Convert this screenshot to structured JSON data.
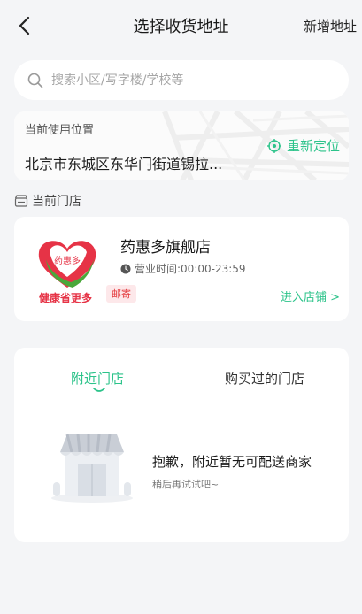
{
  "nav": {
    "title": "选择收货地址",
    "add_address": "新增地址"
  },
  "search": {
    "placeholder": "搜索小区/写字楼/学校等",
    "value": ""
  },
  "location": {
    "label": "当前使用位置",
    "address": "北京市东城区东华门街道锡拉...",
    "relocate": "重新定位"
  },
  "current_store_section": {
    "title": "当前门店"
  },
  "store": {
    "logo_text_top": "药惠多",
    "logo_slogan": "健康省更多",
    "name": "药惠多旗舰店",
    "hours": "营业时间:00:00-23:59",
    "tag": "邮寄",
    "enter": "进入店铺 >"
  },
  "tabs": [
    {
      "label": "附近门店",
      "active": true
    },
    {
      "label": "购买过的门店",
      "active": false
    }
  ],
  "empty": {
    "title": "抱歉，附近暂无可配送商家",
    "subtitle": "稍后再试试吧~"
  },
  "colors": {
    "accent": "#2cc38a",
    "tag_bg": "#fde8ea",
    "tag_text": "#e4393c",
    "background": "#f4f5f7"
  }
}
